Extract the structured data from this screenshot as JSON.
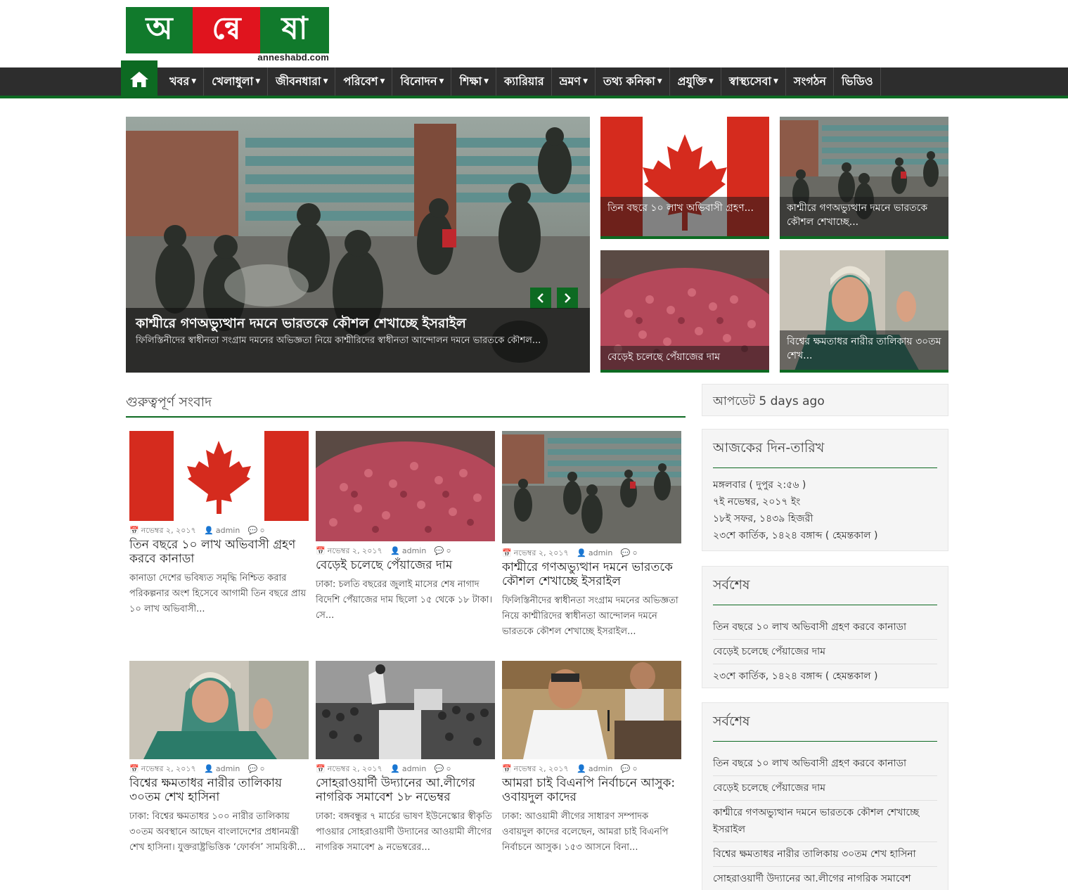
{
  "logo": {
    "syllables": [
      "অ",
      "ন্বে",
      "ষা"
    ],
    "domain": "anneshabd.com"
  },
  "nav": {
    "items": [
      {
        "label": "খবর",
        "caret": true
      },
      {
        "label": "খেলাধুলা",
        "caret": true
      },
      {
        "label": "জীবনধারা",
        "caret": true
      },
      {
        "label": "পরিবেশ",
        "caret": true
      },
      {
        "label": "বিনোদন",
        "caret": true
      },
      {
        "label": "শিক্ষা",
        "caret": true
      },
      {
        "label": "ক্যারিয়ার",
        "caret": false
      },
      {
        "label": "ভ্রমণ",
        "caret": true
      },
      {
        "label": "তথ্য কনিকা",
        "caret": true
      },
      {
        "label": "প্রযুক্তি",
        "caret": true
      },
      {
        "label": "স্বাস্থ্যসেবা",
        "caret": true
      },
      {
        "label": "সংগঠন",
        "caret": false
      },
      {
        "label": "ভিডিও",
        "caret": false
      }
    ],
    "caret_glyph": "▼"
  },
  "slider": {
    "title": "কাশ্মীরে গণঅভ্যুত্থান দমনে ভারতকে কৌশল শেখাচ্ছে ইসরাইল",
    "text": "ফিলিস্তিনীদের স্বাধীনতা সংগ্রাম দমনের অভিজ্ঞতা নিয়ে কাশ্মীরিদের স্বাধীনতা আন্দোলন দমনে ভারতকে কৌশল..."
  },
  "featured": [
    {
      "caption": "তিন বছরে ১০ লাখ অভিবাসী গ্রহণ..."
    },
    {
      "caption": "কাশ্মীরে গণঅভ্যুত্থান দমনে ভারতকে কৌশল শেখাচ্ছে..."
    },
    {
      "caption": "বেড়েই চলেছে পেঁয়াজের দাম"
    },
    {
      "caption": "বিশ্বের ক্ষমতাধর নারীর তালিকায় ৩০তম শেখ..."
    }
  ],
  "main": {
    "section_title": "গুরুত্বপূর্ণ সংবাদ",
    "meta_sep_icons": {
      "date": "📅",
      "user": "👤",
      "comment": "💬"
    },
    "posts": [
      {
        "date": "নভেম্বর ২, ২০১৭",
        "author": "admin",
        "comments": "০",
        "title": "তিন বছরে ১০ লাখ অভিবাসী গ্রহণ করবে কানাডা",
        "text": "কানাডা দেশের ভবিষ্যত সমৃদ্ধি নিশ্চিত করার পরিকল্পনার অংশ হিসেবে আগামী তিন বছরে প্রায় ১০ লাখ অভিবাসী..."
      },
      {
        "date": "নভেম্বর ২, ২০১৭",
        "author": "admin",
        "comments": "০",
        "title": "বেড়েই চলেছে পেঁয়াজের দাম",
        "text": "ঢাকা: চলতি বছরের জুলাই মাসের শেষ নাগাদ বিদেশি পেঁয়াজের দাম ছিলো ১৫ থেকে ১৮ টাকা। সে..."
      },
      {
        "date": "নভেম্বর ২, ২০১৭",
        "author": "admin",
        "comments": "০",
        "title": "কাশ্মীরে গণঅভ্যুত্থান দমনে ভারতকে কৌশল শেখাচ্ছে ইসরাইল",
        "text": "ফিলিস্তিনীদের স্বাধীনতা সংগ্রাম দমনের অভিজ্ঞতা নিয়ে কাশ্মীরিদের স্বাধীনতা আন্দোলন দমনে ভারতকে কৌশল শেখাচ্ছে ইসরাইল..."
      },
      {
        "date": "নভেম্বর ২, ২০১৭",
        "author": "admin",
        "comments": "০",
        "title": "বিশ্বের ক্ষমতাধর নারীর তালিকায় ৩০তম শেখ হাসিনা",
        "text": "ঢাকা: বিশ্বের ক্ষমতাধর ১০০ নারীর তালিকায় ৩০তম অবস্থানে আছেন বাংলাদেশের প্রধানমন্ত্রী শেখ হাসিনা। যুক্তরাষ্ট্রভিত্তিক ‘ফোর্বস’ সাময়িকী..."
      },
      {
        "date": "নভেম্বর ২, ২০১৭",
        "author": "admin",
        "comments": "০",
        "title": "সোহরাওয়ার্দী উদ্যানের আ.লীগের নাগরিক সমাবেশ ১৮ নভেম্বর",
        "text": "ঢাকা: বঙ্গবন্ধুর ৭ মার্চের ভাষণ ইউনেস্কোর স্বীকৃতি পাওয়ার সোহরাওয়ার্দী উদ্যানের আওয়ামী লীগের নাগরিক সমাবেশ ৯ নভেম্বরের..."
      },
      {
        "date": "নভেম্বর ২, ২০১৭",
        "author": "admin",
        "comments": "০",
        "title": "আমরা চাই বিএনপি নির্বাচনে আসুক: ওবায়দুল কাদের",
        "text": "ঢাকা: আওয়ামী লীগের সাধারণ সম্পাদক ওবায়দুল কাদের বলেছেন, আমরা চাই বিএনপি নির্বাচনে আসুক। ১৫৩ আসনে বিনা..."
      }
    ]
  },
  "sidebar": {
    "update_text": "আপডেট 5 days ago",
    "today": {
      "title": "আজকের দিন-তারিখ",
      "lines": [
        "মঙ্গলবার ( দুপুর ২:৫৬ )",
        "৭ই নভেম্বর, ২০১৭ ইং",
        "১৮ই সফর, ১৪৩৯ হিজরী",
        "২৩শে কার্তিক, ১৪২৪ বঙ্গাব্দ ( হেমন্তকাল )"
      ]
    },
    "latest1": {
      "title": "সর্বশেষ",
      "items": [
        "তিন বছরে ১০ লাখ অভিবাসী গ্রহণ করবে কানাডা",
        "বেড়েই চলেছে পেঁয়াজের দাম",
        "২৩শে কার্তিক, ১৪২৪ বঙ্গাব্দ ( হেমন্তকাল )"
      ]
    },
    "latest2": {
      "title": "সর্বশেষ",
      "items": [
        "তিন বছরে ১০ লাখ অভিবাসী গ্রহণ করবে কানাডা",
        "বেড়েই চলেছে পেঁয়াজের দাম",
        "কাশ্মীরে গণঅভ্যুত্থান দমনে ভারতকে কৌশল শেখাচ্ছে ইসরাইল",
        "বিশ্বের ক্ষমতাধর নারীর তালিকায় ৩০তম শেখ হাসিনা",
        "সোহরাওয়ার্দী উদ্যানের আ.লীগের নাগরিক সমাবেশ"
      ]
    }
  },
  "colors": {
    "brand_green": "#0d6a22",
    "brand_red": "#e0141e",
    "nav_bg": "#2d2d2d"
  }
}
